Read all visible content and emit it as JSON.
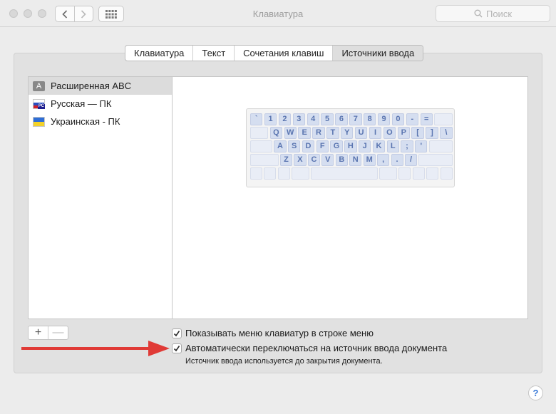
{
  "window": {
    "title": "Клавиатура"
  },
  "search": {
    "placeholder": "Поиск"
  },
  "tabs": [
    {
      "label": "Клавиатура",
      "active": false
    },
    {
      "label": "Текст",
      "active": false
    },
    {
      "label": "Сочетания клавиш",
      "active": false
    },
    {
      "label": "Источники ввода",
      "active": true
    }
  ],
  "sources": [
    {
      "label": "Расширенная ABC",
      "icon": "letter-a-icon",
      "selected": true
    },
    {
      "label": "Русская — ПК",
      "icon": "flag-russia-icon",
      "selected": false
    },
    {
      "label": "Украинская - ПК",
      "icon": "flag-ukraine-icon",
      "selected": false
    }
  ],
  "keyboard": {
    "row1": [
      "`",
      "1",
      "2",
      "3",
      "4",
      "5",
      "6",
      "7",
      "8",
      "9",
      "0",
      "-",
      "="
    ],
    "row2": [
      "Q",
      "W",
      "E",
      "R",
      "T",
      "Y",
      "U",
      "I",
      "O",
      "P",
      "[",
      "]",
      "\\"
    ],
    "row3": [
      "A",
      "S",
      "D",
      "F",
      "G",
      "H",
      "J",
      "K",
      "L",
      ";",
      "'"
    ],
    "row4": [
      "Z",
      "X",
      "C",
      "V",
      "B",
      "N",
      "M",
      ",",
      ".",
      "/"
    ]
  },
  "buttons": {
    "add": "+",
    "remove": "—",
    "help": "?"
  },
  "options": {
    "show_menu_label": "Показывать меню клавиатур в строке меню",
    "show_menu_checked": true,
    "auto_switch_label": "Автоматически переключаться на источник ввода документа",
    "auto_switch_checked": true,
    "auto_switch_note": "Источник ввода используется до закрытия документа."
  },
  "colors": {
    "arrow": "#e03a36",
    "help_accent": "#3a7bd8",
    "key_text": "#5a75b0"
  }
}
